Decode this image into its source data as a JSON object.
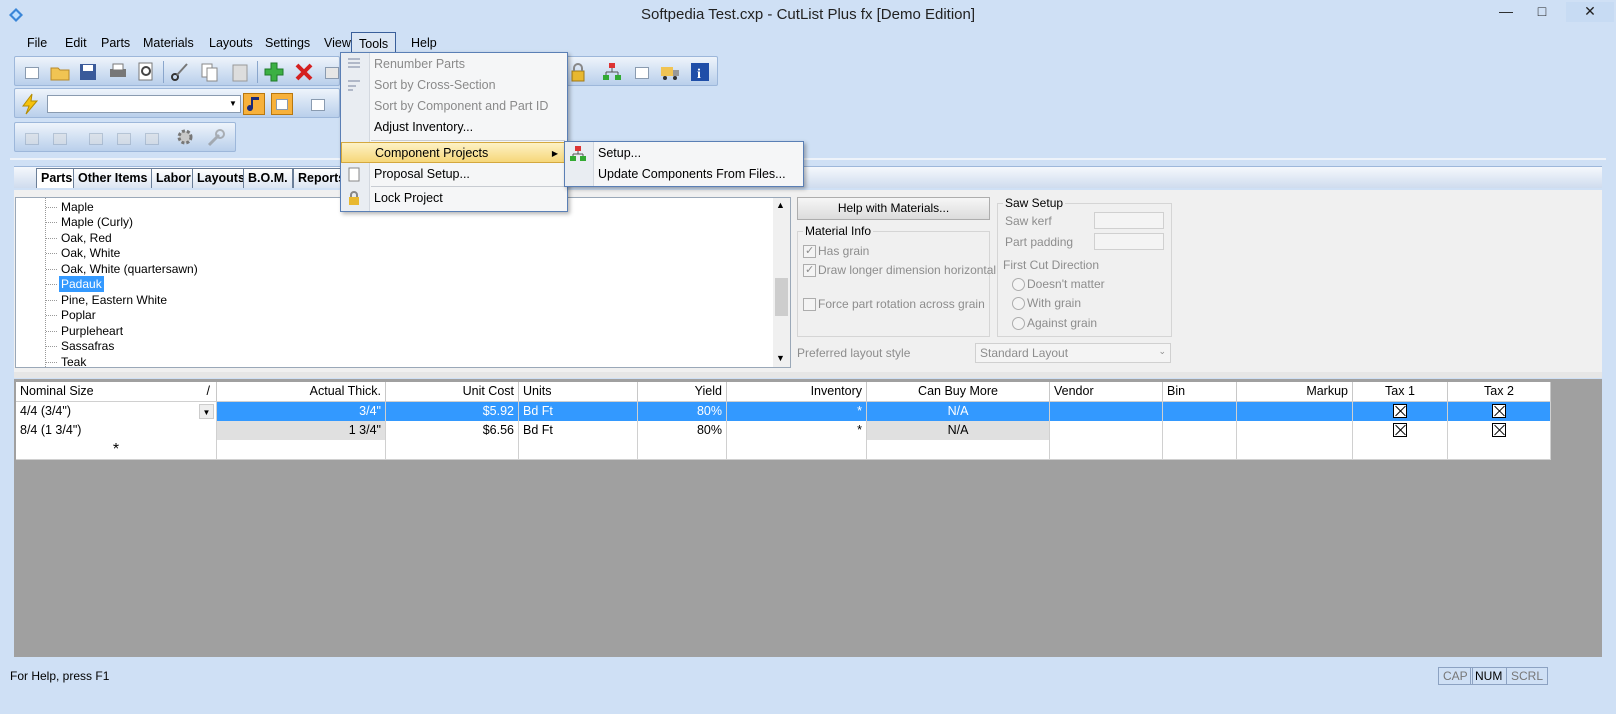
{
  "window": {
    "title": "Softpedia Test.cxp - CutList Plus fx [Demo Edition]",
    "minimize_icon": "minimize-icon",
    "maximize_icon": "maximize-icon",
    "close_icon": "close-icon",
    "minimize": "—",
    "maximize": "□",
    "close": "✕"
  },
  "menubar": {
    "items": [
      "File",
      "Edit",
      "Parts",
      "Materials",
      "Layouts",
      "Settings",
      "View",
      "Tools",
      "Help"
    ],
    "active": "Tools"
  },
  "toolbar": {
    "material_select_value": "",
    "icons": [
      "new-icon",
      "open-icon",
      "save-icon",
      "print-icon",
      "print-preview-icon",
      "cut-icon",
      "copy-icon",
      "paste-icon",
      "add-icon",
      "delete-icon",
      "lock-icon",
      "component-tree-icon",
      "document-icon",
      "truck-icon",
      "info-icon",
      "lightning-icon",
      "note-icon",
      "list-icon",
      "report-icon"
    ]
  },
  "tabs": [
    "Parts",
    "Other Items",
    "Labor",
    "Layouts",
    "B.O.M.",
    "Reports"
  ],
  "tree": {
    "items": [
      "Maple",
      "Maple (Curly)",
      "Oak, Red",
      "Oak, White",
      "Oak, White (quartersawn)",
      "Padauk",
      "Pine, Eastern White",
      "Poplar",
      "Purpleheart",
      "Sassafras",
      "Teak"
    ],
    "selected": "Padauk"
  },
  "material_settings": {
    "help_button": "Help with Materials...",
    "material_info_label": "Material Info",
    "has_grain": "Has grain",
    "draw_longer": "Draw longer dimension horizontal",
    "force_rotation": "Force part rotation across grain",
    "preferred_layout_label": "Preferred layout style",
    "preferred_layout_value": "Standard Layout",
    "has_grain_checked": true,
    "draw_longer_checked": true,
    "force_rotation_checked": false
  },
  "saw_setup": {
    "title": "Saw Setup",
    "saw_kerf": "Saw kerf",
    "part_padding": "Part padding",
    "first_cut_direction": "First Cut Direction",
    "options": [
      "Doesn't matter",
      "With grain",
      "Against grain"
    ]
  },
  "grid": {
    "sort_glyph": "/",
    "headers": [
      "Nominal Size",
      "Actual Thick.",
      "Unit Cost",
      "Units",
      "Yield",
      "Inventory",
      "Can Buy More",
      "Vendor",
      "Bin",
      "Markup",
      "Tax 1",
      "Tax 2"
    ],
    "rows": [
      {
        "nominal": "4/4 (3/4\")",
        "actual": "3/4\"",
        "cost": "$5.92",
        "units": "Bd Ft",
        "yield": "80%",
        "inventory": "*",
        "can_buy": "N/A",
        "vendor": "",
        "bin": "",
        "markup": "",
        "tax1": true,
        "tax2": true
      },
      {
        "nominal": "8/4 (1 3/4\")",
        "actual": "1 3/4\"",
        "cost": "$6.56",
        "units": "Bd Ft",
        "yield": "80%",
        "inventory": "*",
        "can_buy": "N/A",
        "vendor": "",
        "bin": "",
        "markup": "",
        "tax1": true,
        "tax2": true
      }
    ],
    "new_row_marker": "*"
  },
  "tools_menu": {
    "items": [
      {
        "label": "Renumber Parts",
        "disabled": true,
        "icon": "renumber-icon"
      },
      {
        "label": "Sort by Cross-Section",
        "disabled": true,
        "icon": "sort-icon"
      },
      {
        "label": "Sort by Component and Part ID",
        "disabled": true,
        "icon": ""
      },
      {
        "label": "Adjust Inventory...",
        "disabled": false,
        "icon": ""
      },
      {
        "label": "Component Projects",
        "disabled": false,
        "icon": "",
        "submenu_arrow": "▶"
      },
      {
        "label": "Proposal Setup...",
        "disabled": false,
        "icon": "proposal-icon"
      },
      {
        "label": "Lock Project",
        "disabled": false,
        "icon": "lock-icon"
      }
    ]
  },
  "component_submenu": {
    "items": [
      "Setup...",
      "Update Components From Files..."
    ],
    "icon": "component-tree-icon"
  },
  "statusbar": {
    "help_text": "For Help, press F1",
    "indicators": [
      "CAP",
      "NUM",
      "SCRL"
    ],
    "active_indicator": "NUM"
  }
}
